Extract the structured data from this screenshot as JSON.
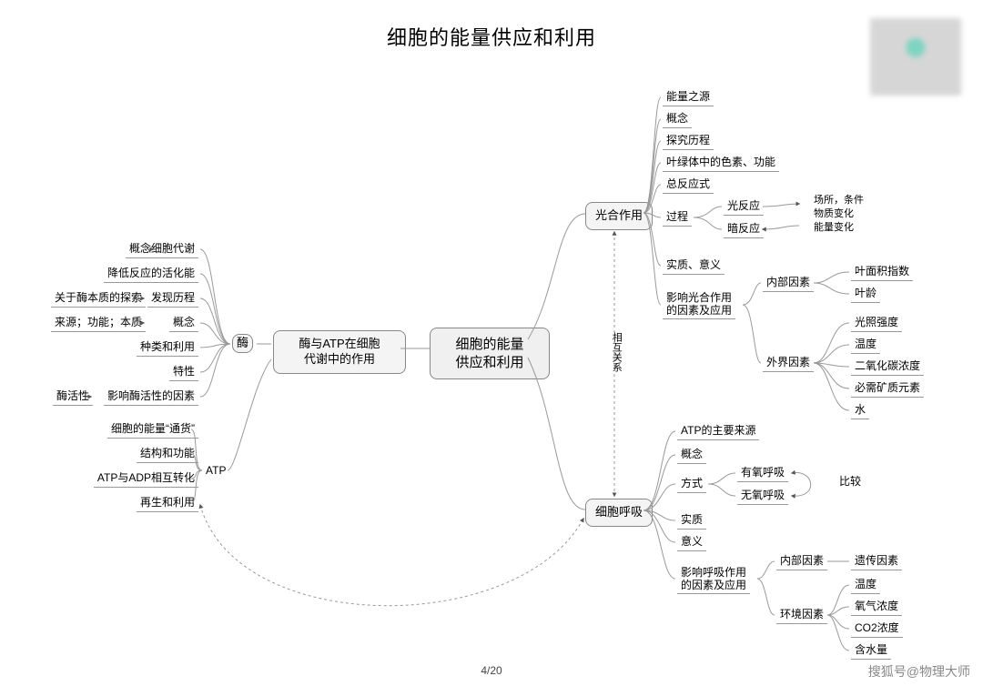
{
  "title": "细胞的能量供应和利用",
  "page": "4/20",
  "watermark": "搜狐号@物理大师",
  "center": "细胞的能量\n供应和利用",
  "left_branch": {
    "node": "酶与ATP在细胞\n代谢中的作用",
    "enzyme_label": "酶",
    "atp_label": "ATP",
    "enzyme": {
      "concept": "概念",
      "concept_sub": "细胞代谢",
      "lower_activation": "降低反应的活化能",
      "history": "发现历程",
      "history_sub": "关于酶本质的探索",
      "concept2": "概念",
      "concept2_sub": "来源；功能；本质",
      "types": "种类和利用",
      "properties": "特性",
      "factors": "影响酶活性的因素",
      "factors_sub": "酶活性"
    },
    "atp": {
      "currency": "细胞的能量“通货”",
      "structure": "结构和功能",
      "conversion": "ATP与ADP相互转化",
      "regen": "再生和利用"
    }
  },
  "relation_label": "相互关系",
  "photosynthesis": {
    "node": "光合作用",
    "items": {
      "source": "能量之源",
      "concept": "概念",
      "history": "探究历程",
      "pigment": "叶绿体中的色素、功能",
      "equation": "总反应式",
      "process": "过程",
      "light_rxn": "光反应",
      "dark_rxn": "暗反应",
      "process_note1": "场所，条件",
      "process_note2": "物质变化",
      "process_note3": "能量变化",
      "essence": "实质、意义",
      "factors": "影响光合作用\n的因素及应用",
      "internal": "内部因素",
      "leaf_area": "叶面积指数",
      "leaf_age": "叶龄",
      "external": "外界因素",
      "light_intensity": "光照强度",
      "temperature": "温度",
      "co2": "二氧化碳浓度",
      "minerals": "必需矿质元素",
      "water": "水"
    }
  },
  "respiration": {
    "node": "细胞呼吸",
    "items": {
      "atp_source": "ATP的主要来源",
      "concept": "概念",
      "mode": "方式",
      "aerobic": "有氧呼吸",
      "anaerobic": "无氧呼吸",
      "compare": "比较",
      "essence": "实质",
      "meaning": "意义",
      "factors": "影响呼吸作用\n的因素及应用",
      "internal": "内部因素",
      "genetic": "遗传因素",
      "external": "环境因素",
      "temperature": "温度",
      "o2": "氧气浓度",
      "co2": "CO2浓度",
      "water": "含水量"
    }
  }
}
